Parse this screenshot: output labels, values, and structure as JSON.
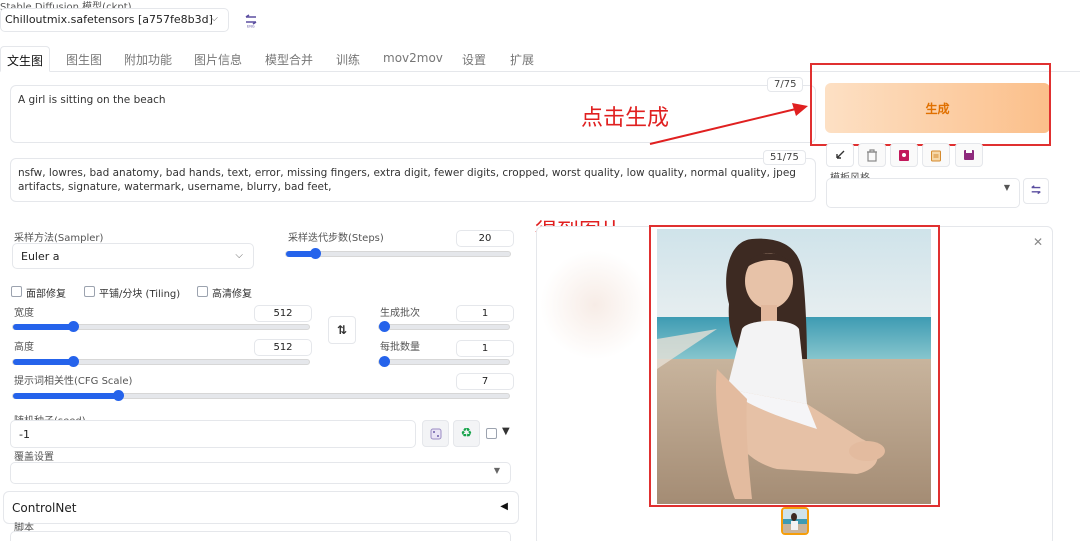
{
  "header": {
    "model_label": "Stable Diffusion 模型(ckpt)",
    "model_value": "Chilloutmix.safetensors [a757fe8b3d]"
  },
  "tabs": [
    {
      "label": "文生图",
      "active": true
    },
    {
      "label": "图生图"
    },
    {
      "label": "附加功能"
    },
    {
      "label": "图片信息"
    },
    {
      "label": "模型合并"
    },
    {
      "label": "训练"
    },
    {
      "label": "mov2mov"
    },
    {
      "label": "设置"
    },
    {
      "label": "扩展"
    }
  ],
  "prompt": {
    "positive_text": "A girl is sitting on the beach",
    "positive_counter": "7/75",
    "negative_text": "nsfw, lowres, bad anatomy, bad hands, text, error, missing fingers, extra digit, fewer digits, cropped, worst quality, low quality, normal quality, jpeg artifacts, signature, watermark, username, blurry, bad feet,",
    "negative_counter": "51/75"
  },
  "generate": {
    "button_label": "生成",
    "style_label": "模板风格"
  },
  "annotations": {
    "click_generate": "点击生成",
    "got_image": "得到图片"
  },
  "sampler": {
    "label": "采样方法(Sampler)",
    "value": "Euler a"
  },
  "steps": {
    "label": "采样迭代步数(Steps)",
    "value": "20",
    "fraction": 0.13
  },
  "options": {
    "face_restore": "面部修复",
    "tiling": "平铺/分块 (Tiling)",
    "hires_fix": "高清修复"
  },
  "width": {
    "label": "宽度",
    "value": "512",
    "fraction": 0.2
  },
  "height": {
    "label": "高度",
    "value": "512",
    "fraction": 0.2
  },
  "batch_count": {
    "label": "生成批次",
    "value": "1",
    "fraction": 0.0
  },
  "batch_size": {
    "label": "每批数量",
    "value": "1",
    "fraction": 0.0
  },
  "cfg": {
    "label": "提示词相关性(CFG Scale)",
    "value": "7",
    "fraction": 0.21
  },
  "seed": {
    "label": "随机种子(seed)",
    "value": "-1"
  },
  "override": {
    "label": "覆盖设置"
  },
  "controlnet": {
    "label": "ControlNet"
  },
  "script": {
    "label": "脚本"
  },
  "colors": {
    "accent": "#2563eb",
    "generate_text": "#e07000",
    "annotation_red": "#e02020"
  }
}
